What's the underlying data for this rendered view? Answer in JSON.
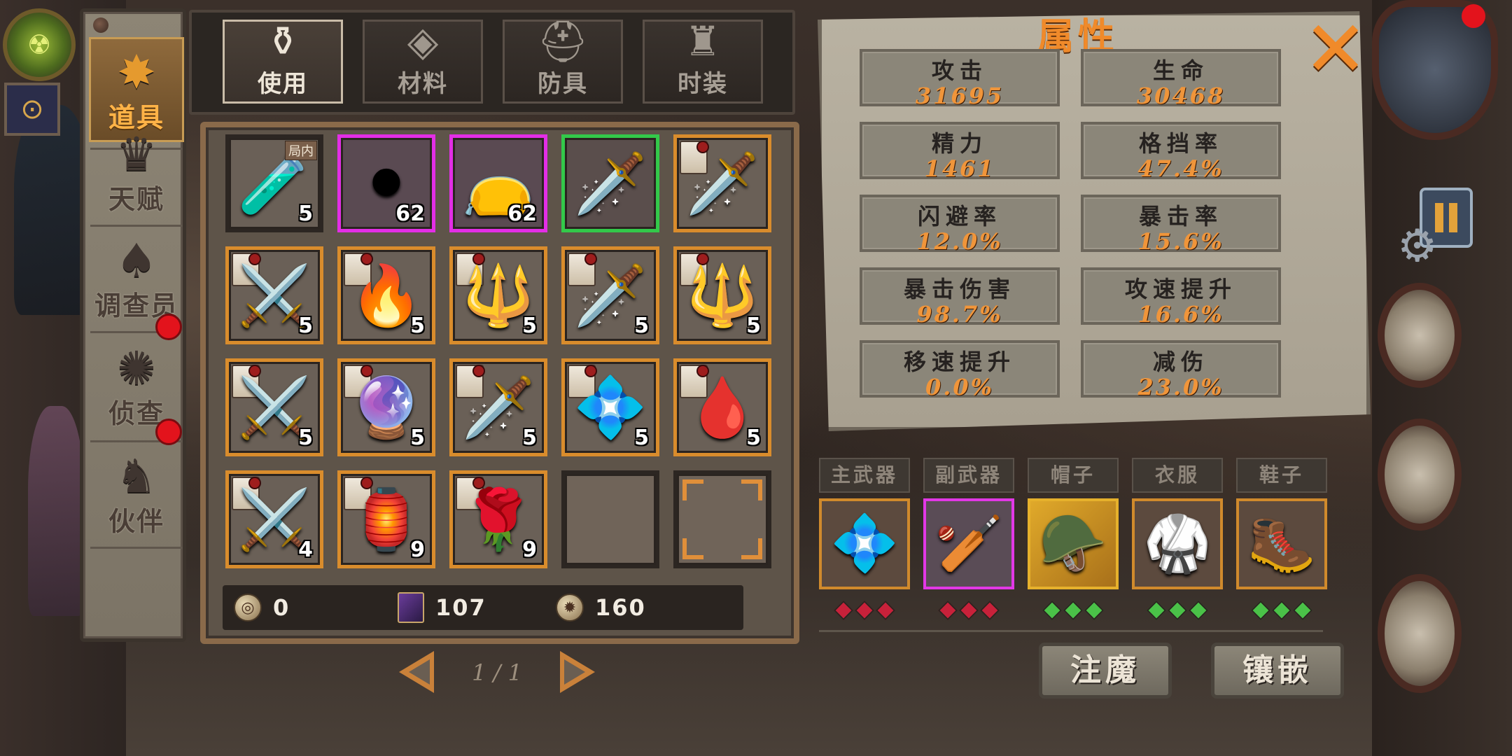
{
  "side_nav": {
    "items": [
      {
        "label": "道具",
        "icon": "potion-bag-icon",
        "active": true,
        "badge": false
      },
      {
        "label": "天赋",
        "icon": "talent-icon",
        "active": false,
        "badge": false
      },
      {
        "label": "调查员",
        "icon": "investigator-icon",
        "active": false,
        "badge": true
      },
      {
        "label": "侦查",
        "icon": "detect-icon",
        "active": false,
        "badge": true
      },
      {
        "label": "伙伴",
        "icon": "partner-icon",
        "active": false,
        "badge": false
      }
    ]
  },
  "tabs": [
    {
      "label": "使用",
      "icon": "potion-bottle-icon",
      "active": true
    },
    {
      "label": "材料",
      "icon": "material-icon",
      "active": false
    },
    {
      "label": "防具",
      "icon": "helmet-icon",
      "active": false
    },
    {
      "label": "时装",
      "icon": "top-hat-icon",
      "active": false
    }
  ],
  "inventory": {
    "slots": [
      {
        "name": "red-potion",
        "art": "🧪",
        "qty": "5",
        "tag": "局内",
        "rarity": "plain"
      },
      {
        "name": "dark-core",
        "art": "⚫",
        "qty": "62",
        "tag": "",
        "rarity": "purple"
      },
      {
        "name": "sack",
        "art": "👝",
        "qty": "62",
        "tag": "",
        "rarity": "purple"
      },
      {
        "name": "crimson-scythe",
        "art": "🗡️",
        "qty": "",
        "tag": "",
        "rarity": "green"
      },
      {
        "name": "dark-spear-scroll",
        "art": "🗡️",
        "qty": "",
        "tag": "",
        "rarity": "orange",
        "scroll": true
      },
      {
        "name": "cyan-scythe-scroll",
        "art": "⚔️",
        "qty": "5",
        "tag": "",
        "rarity": "orange",
        "scroll": true
      },
      {
        "name": "flame-claw-scroll",
        "art": "🔥",
        "qty": "5",
        "tag": "",
        "rarity": "orange",
        "scroll": true
      },
      {
        "name": "eye-staff-scroll",
        "art": "🔱",
        "qty": "5",
        "tag": "",
        "rarity": "orange",
        "scroll": true
      },
      {
        "name": "golden-spear-scroll",
        "art": "🗡️",
        "qty": "5",
        "tag": "",
        "rarity": "orange",
        "scroll": true
      },
      {
        "name": "trident-scroll",
        "art": "🔱",
        "qty": "5",
        "tag": "",
        "rarity": "orange",
        "scroll": true
      },
      {
        "name": "violet-scythe-scroll",
        "art": "⚔️",
        "qty": "5",
        "tag": "",
        "rarity": "orange",
        "scroll": true
      },
      {
        "name": "orb-staff-scroll",
        "art": "🔮",
        "qty": "5",
        "tag": "",
        "rarity": "orange",
        "scroll": true
      },
      {
        "name": "pink-lance-scroll",
        "art": "🗡️",
        "qty": "5",
        "tag": "",
        "rarity": "orange",
        "scroll": true
      },
      {
        "name": "blue-claw-scroll",
        "art": "💠",
        "qty": "5",
        "tag": "",
        "rarity": "orange",
        "scroll": true
      },
      {
        "name": "blood-staff-scroll",
        "art": "🩸",
        "qty": "5",
        "tag": "",
        "rarity": "orange",
        "scroll": true
      },
      {
        "name": "jade-blade-scroll",
        "art": "⚔️",
        "qty": "4",
        "tag": "",
        "rarity": "orange",
        "scroll": true
      },
      {
        "name": "lantern-staff-scroll",
        "art": "🏮",
        "qty": "9",
        "tag": "",
        "rarity": "orange",
        "scroll": true
      },
      {
        "name": "rose-scythe-scroll",
        "art": "🌹",
        "qty": "9",
        "tag": "",
        "rarity": "orange",
        "scroll": true
      },
      {
        "name": "empty",
        "art": "",
        "qty": "",
        "tag": "",
        "rarity": "empty"
      },
      {
        "name": "selected-empty",
        "art": "",
        "qty": "",
        "tag": "",
        "rarity": "selected"
      }
    ]
  },
  "currency": {
    "coin": "0",
    "book": "107",
    "gear_coin": "160"
  },
  "pager": {
    "text": "1 / 1"
  },
  "attributes": {
    "title": "属性",
    "stats": [
      {
        "label": "攻击",
        "value": "31695"
      },
      {
        "label": "生命",
        "value": "30468"
      },
      {
        "label": "精力",
        "value": "1461"
      },
      {
        "label": "格挡率",
        "value": "47.4%"
      },
      {
        "label": "闪避率",
        "value": "12.0%"
      },
      {
        "label": "暴击率",
        "value": "15.6%"
      },
      {
        "label": "暴击伤害",
        "value": "98.7%"
      },
      {
        "label": "攻速提升",
        "value": "16.6%"
      },
      {
        "label": "移速提升",
        "value": "0.0%"
      },
      {
        "label": "减伤",
        "value": "23.0%"
      }
    ]
  },
  "equipment": [
    {
      "label": "主武器",
      "art": "💠",
      "rarity": "orange",
      "gem_color": "red"
    },
    {
      "label": "副武器",
      "art": "🏏",
      "rarity": "purple",
      "gem_color": "red"
    },
    {
      "label": "帽子",
      "art": "🪖",
      "rarity": "gold",
      "gem_color": "green"
    },
    {
      "label": "衣服",
      "art": "🥋",
      "rarity": "orange",
      "gem_color": "green"
    },
    {
      "label": "鞋子",
      "art": "🥾",
      "rarity": "orange",
      "gem_color": "green"
    }
  ],
  "actions": {
    "enchant": "注魔",
    "inlay": "镶嵌"
  },
  "colors": {
    "accent_orange": "#f08a2a",
    "rarity_orange": "#d98c2c",
    "rarity_purple": "#e32ee6",
    "rarity_green": "#33c94a",
    "badge_red": "#e3131c"
  }
}
